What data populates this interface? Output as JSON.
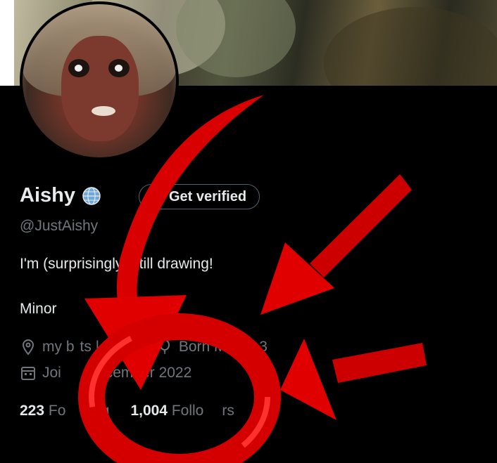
{
  "profile": {
    "display_name": "Aishy",
    "handle": "@JustAishy",
    "verify_button_label": "Get verified",
    "bio": "I'm (surprisingly) still drawing!",
    "bio_line2": "Minor",
    "location_text": "my b",
    "location_tail": "ts |  he/h",
    "birth_text": "Born March 3",
    "joined_text": "Joi",
    "joined_tail": "December 2022"
  },
  "stats": {
    "following_count": "223",
    "following_label": "Fo",
    "following_label_tail": "ing",
    "followers_count": "1,004",
    "followers_label": "Follo",
    "followers_label_tail": "rs"
  },
  "icons": {
    "globe": "globe-icon",
    "verified_badge": "verified-badge-icon",
    "location": "location-pin-icon",
    "birthday": "balloon-icon",
    "calendar": "calendar-icon"
  },
  "colors": {
    "background": "#000000",
    "primary_text": "#e7e9ea",
    "secondary_text": "#71767b",
    "verified_blue": "#1d9bf0",
    "annotation_red": "#e00000"
  }
}
